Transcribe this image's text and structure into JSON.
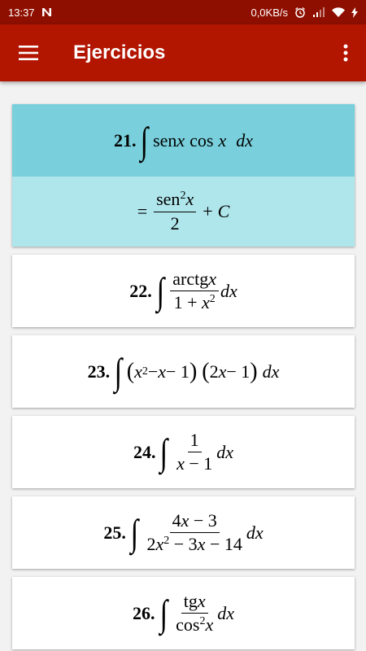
{
  "status_bar": {
    "time": "13:37",
    "speed": "0,0KB/s",
    "icons": [
      "notification-n-icon",
      "alarm-icon",
      "signal-icon",
      "wifi-icon",
      "charging-icon"
    ]
  },
  "app_bar": {
    "title": "Ejercicios",
    "menu_icon": "hamburger-menu-icon",
    "more_icon": "more-vert-icon"
  },
  "colors": {
    "status_bar": "#8e0f00",
    "app_bar": "#b21500",
    "selected_question": "#79d0dc",
    "selected_answer": "#afe6ec"
  },
  "exercises": [
    {
      "number": "21.",
      "integrand": [
        "sen",
        "x",
        "cos",
        "x",
        "dx"
      ],
      "expanded": true,
      "answer": {
        "eq": "=",
        "num_fn": "sen",
        "num_exp": "2",
        "num_var": "x",
        "den": "2",
        "plus": "+",
        "const": "C"
      }
    },
    {
      "number": "22.",
      "num": "arctg",
      "num_var": "x",
      "den_a": "1 + ",
      "den_var": "x",
      "den_exp": "2",
      "diff": "dx"
    },
    {
      "number": "23.",
      "p1_var": "x",
      "p1_exp": "2",
      "p1_rest_a": " − ",
      "p1_var2": "x",
      "p1_rest_b": " − 1",
      "p2_a": "2",
      "p2_var": "x",
      "p2_b": " − 1",
      "diff": "dx"
    },
    {
      "number": "24.",
      "num": "1",
      "den_var": "x",
      "den_rest": " − 1",
      "diff": "dx"
    },
    {
      "number": "25.",
      "num_a": "4",
      "num_var": "x",
      "num_b": " − 3",
      "den_a": "2",
      "den_var": "x",
      "den_exp": "2",
      "den_b": " − 3",
      "den_var2": "x",
      "den_c": " − 14",
      "diff": "dx"
    },
    {
      "number": "26.",
      "num": "tg",
      "num_var": "x",
      "den": "cos",
      "den_exp": "2",
      "den_var": "x",
      "diff": "dx"
    }
  ]
}
